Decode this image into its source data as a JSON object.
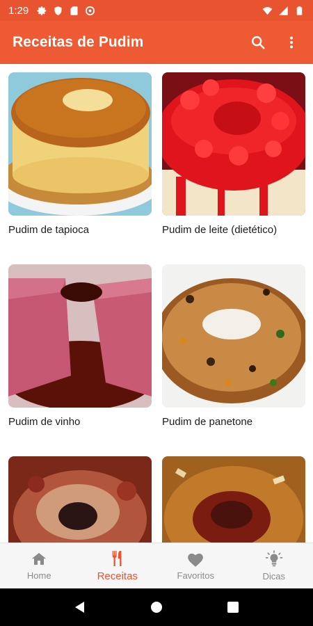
{
  "status_bar": {
    "time": "1:29"
  },
  "app_bar": {
    "title": "Receitas de Pudim",
    "search_icon": "search-icon",
    "more_icon": "more-vert-icon"
  },
  "recipes": [
    {
      "name": "Pudim de tapioca"
    },
    {
      "name": "Pudim de leite (dietético)"
    },
    {
      "name": "Pudim de vinho"
    },
    {
      "name": "Pudim de panetone"
    },
    {
      "name": ""
    },
    {
      "name": ""
    }
  ],
  "bottom_nav": {
    "items": [
      {
        "label": "Home",
        "icon": "home-icon",
        "active": false
      },
      {
        "label": "Receitas",
        "icon": "utensils-icon",
        "active": true
      },
      {
        "label": "Favoritos",
        "icon": "heart-icon",
        "active": false
      },
      {
        "label": "Dicas",
        "icon": "lightbulb-icon",
        "active": false
      }
    ]
  },
  "colors": {
    "primary": "#ee5a33",
    "status_bar": "#e8542f",
    "active_nav": "#e8542f",
    "inactive_nav": "#8a8a8a"
  }
}
